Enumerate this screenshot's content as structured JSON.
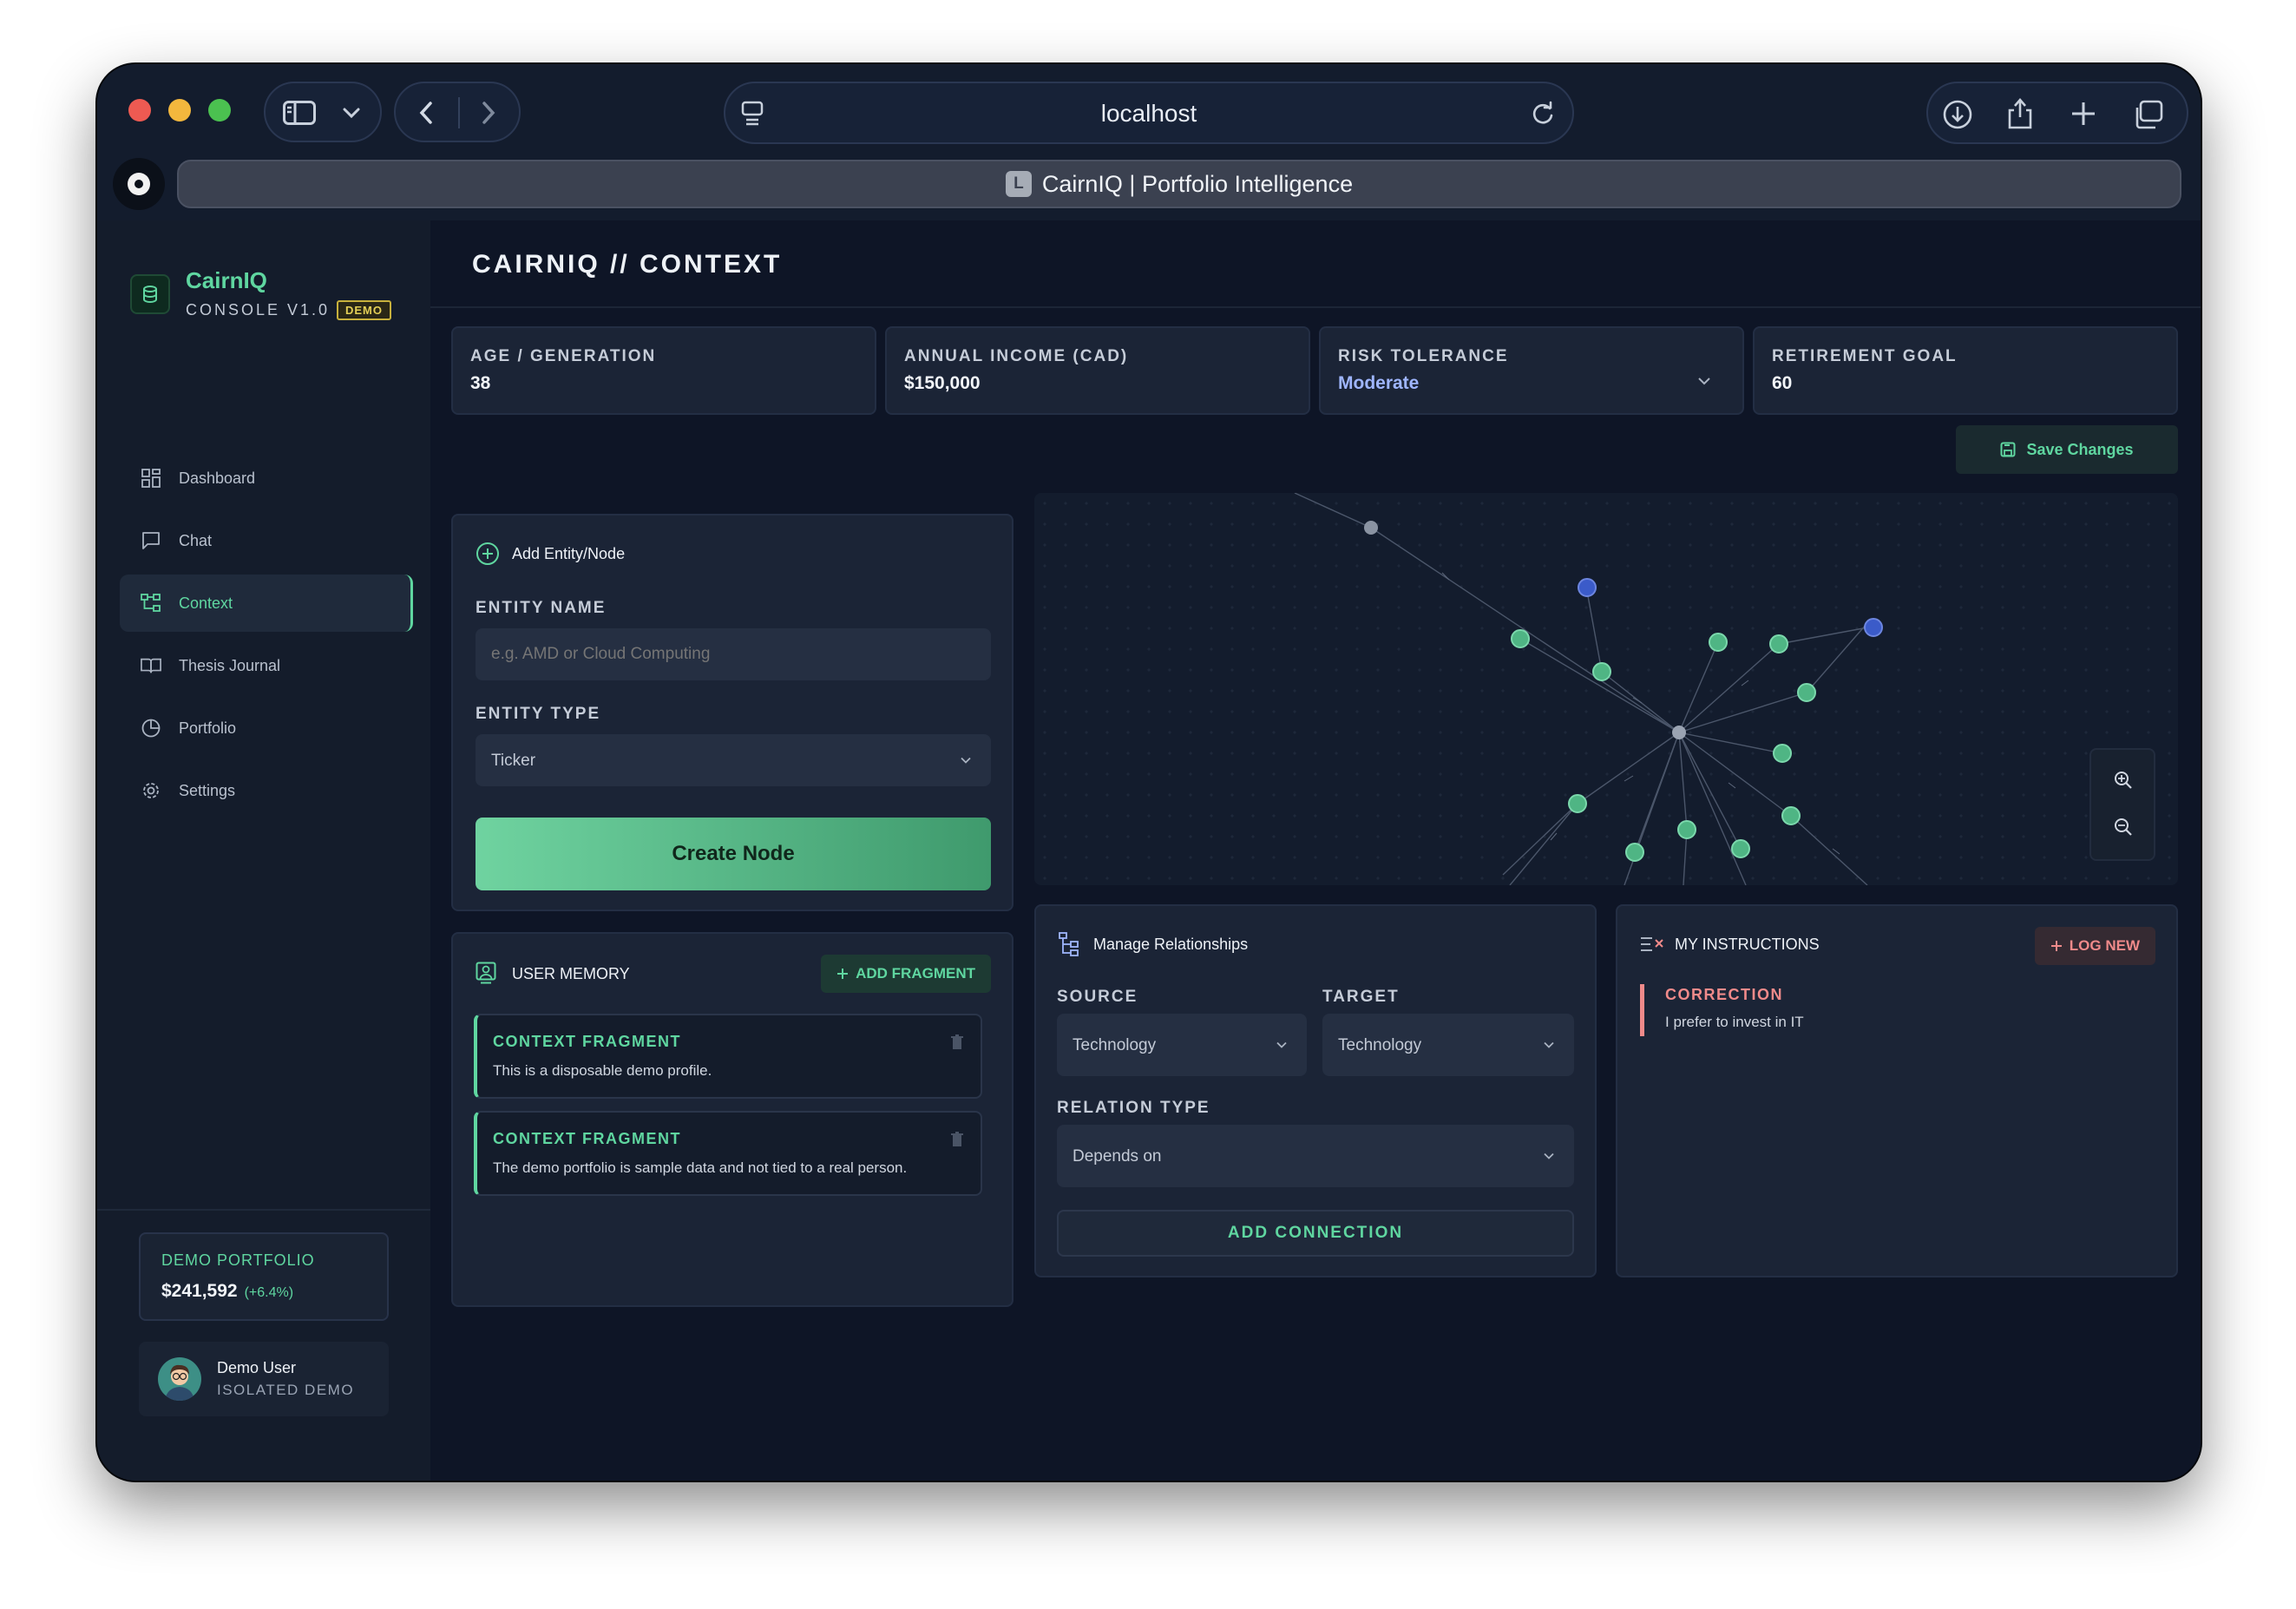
{
  "browser": {
    "url": "localhost",
    "tab_title": "CairnIQ | Portfolio Intelligence",
    "tab_badge": "L"
  },
  "brand": {
    "name": "CairnIQ",
    "subtitle": "CONSOLE V1.0",
    "badge": "DEMO"
  },
  "sidebar": {
    "items": [
      {
        "label": "Dashboard",
        "icon": "grid-icon"
      },
      {
        "label": "Chat",
        "icon": "chat-icon"
      },
      {
        "label": "Context",
        "icon": "network-icon",
        "active": true
      },
      {
        "label": "Thesis Journal",
        "icon": "book-icon"
      },
      {
        "label": "Portfolio",
        "icon": "pie-chart-icon"
      },
      {
        "label": "Settings",
        "icon": "gear-icon"
      }
    ],
    "portfolio": {
      "label": "DEMO PORTFOLIO",
      "value": "$241,592",
      "change": "(+6.4%)"
    },
    "user": {
      "name": "Demo User",
      "role": "ISOLATED DEMO"
    }
  },
  "page": {
    "title": "CAIRNIQ // CONTEXT"
  },
  "profile": {
    "age_label": "AGE / GENERATION",
    "age_value": "38",
    "income_label": "ANNUAL INCOME (CAD)",
    "income_value": "$150,000",
    "risk_label": "RISK TOLERANCE",
    "risk_value": "Moderate",
    "goal_label": "RETIREMENT GOAL",
    "goal_value": "60",
    "save_label": "Save Changes"
  },
  "add_node": {
    "title": "Add Entity/Node",
    "name_label": "ENTITY NAME",
    "name_placeholder": "e.g. AMD or Cloud Computing",
    "type_label": "ENTITY TYPE",
    "type_value": "Ticker",
    "create_label": "Create Node"
  },
  "memory": {
    "title": "USER MEMORY",
    "add_label": "ADD FRAGMENT",
    "fragments": [
      {
        "title": "CONTEXT FRAGMENT",
        "text": "This is a disposable demo profile."
      },
      {
        "title": "CONTEXT FRAGMENT",
        "text": "The demo portfolio is sample data and not tied to a real person."
      }
    ]
  },
  "relationships": {
    "title": "Manage Relationships",
    "source_label": "SOURCE",
    "source_value": "Technology",
    "target_label": "TARGET",
    "target_value": "Technology",
    "relation_label": "RELATION TYPE",
    "relation_value": "Depends on",
    "add_label": "ADD CONNECTION"
  },
  "instructions": {
    "title": "MY INSTRUCTIONS",
    "log_label": "LOG NEW",
    "items": [
      {
        "title": "CORRECTION",
        "text": "I prefer to invest in IT"
      }
    ]
  },
  "colors": {
    "accent": "#5fd6a0",
    "danger": "#f08a8a",
    "window_bg": "#101726"
  }
}
